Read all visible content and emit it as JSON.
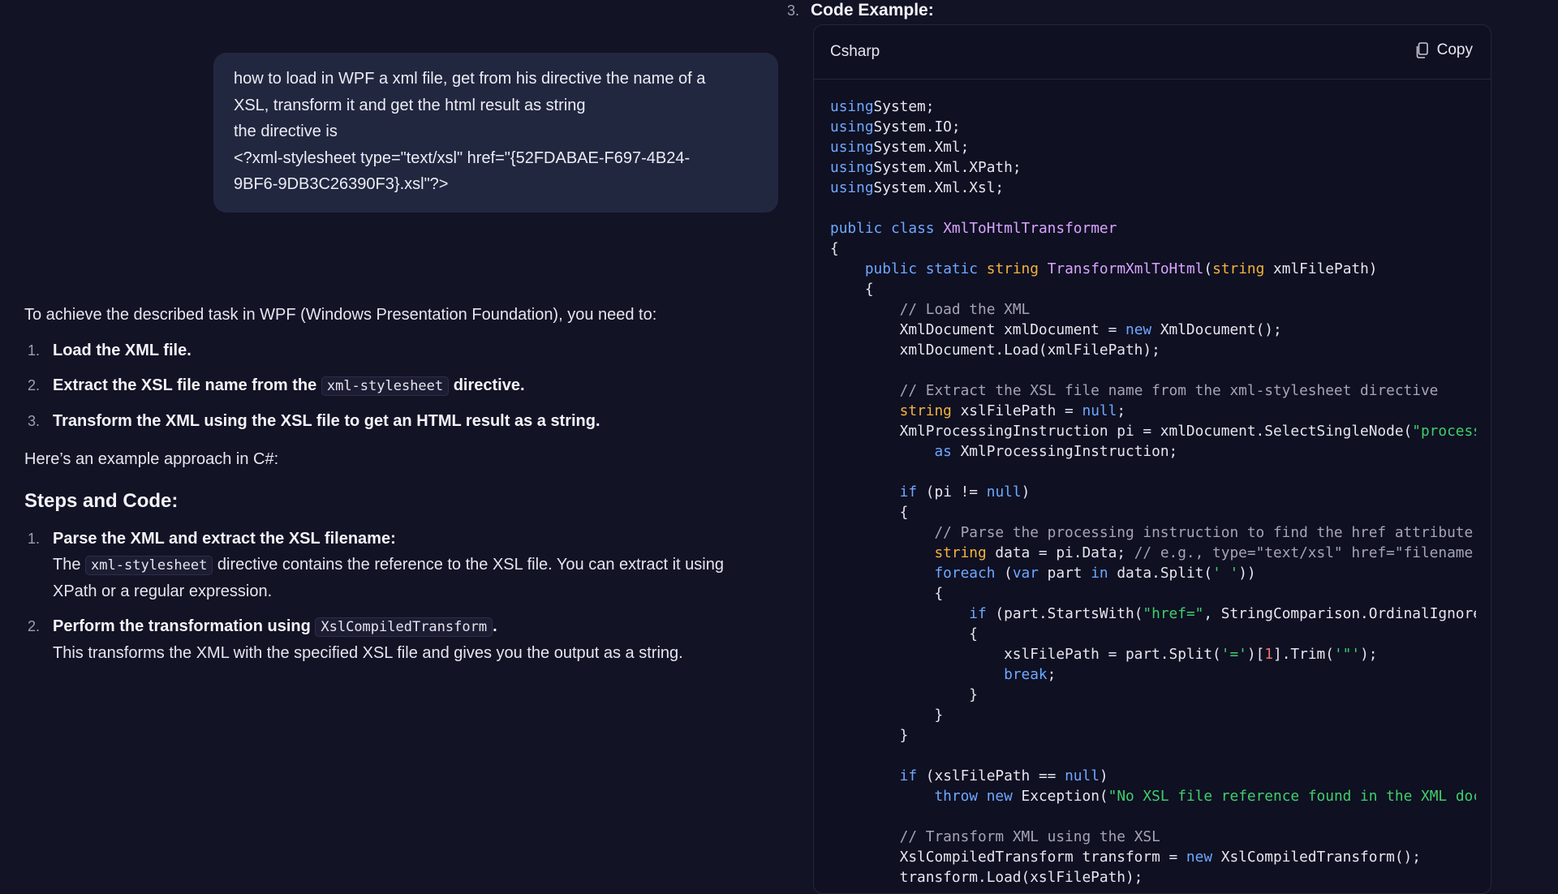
{
  "user_message": {
    "lines": [
      "how to load in WPF a xml file, get from his directive the name of a",
      "XSL, transform it and get the html result as string",
      "the directive is",
      "<?xml-stylesheet type=\"text/xsl\" href=\"{52FDABAE-F697-4B24-",
      "9BF6-9DB3C26390F3}.xsl\"?>"
    ]
  },
  "answer": {
    "intro": "To achieve the described task in WPF (Windows Presentation Foundation), you need to:",
    "steps": [
      {
        "num": "1.",
        "text": "Load the XML file."
      },
      {
        "num": "2.",
        "before": "Extract the XSL file name from the ",
        "code": "xml-stylesheet",
        "after": " directive."
      },
      {
        "num": "3.",
        "text": "Transform the XML using the XSL file to get an HTML result as a string."
      }
    ],
    "example_line": "Here’s an example approach in C#:",
    "section_title": "Steps and Code:",
    "sub_steps": [
      {
        "num": "1.",
        "title": "Parse the XML and extract the XSL filename:",
        "desc_before": "The ",
        "desc_code": "xml-stylesheet",
        "desc_after": " directive contains the reference to the XSL file. You can extract it using XPath or a regular expression."
      },
      {
        "num": "2.",
        "title": "Perform the transformation using ",
        "title_code": "XslCompiledTransform",
        "title_after": ".",
        "desc": "This transforms the XML with the specified XSL file and gives you the output as a string."
      }
    ]
  },
  "code_section": {
    "step_num": "3.",
    "step_title": "Code Example:",
    "language": "Csharp",
    "copy_label": "Copy",
    "lines": [
      [
        [
          "kw",
          "using"
        ],
        [
          "",
          "System;"
        ]
      ],
      [
        [
          "kw",
          "using"
        ],
        [
          "",
          "System.IO;"
        ]
      ],
      [
        [
          "kw",
          "using"
        ],
        [
          "",
          "System.Xml;"
        ]
      ],
      [
        [
          "kw",
          "using"
        ],
        [
          "",
          "System.Xml.XPath;"
        ]
      ],
      [
        [
          "kw",
          "using"
        ],
        [
          "",
          "System.Xml.Xsl;"
        ]
      ],
      [],
      [
        [
          "kw",
          "public"
        ],
        [
          "",
          " "
        ],
        [
          "kw",
          "class"
        ],
        [
          "",
          " "
        ],
        [
          "fn",
          "XmlToHtmlTransformer"
        ]
      ],
      [
        [
          "",
          "{"
        ]
      ],
      [
        [
          "",
          "    "
        ],
        [
          "kw",
          "public"
        ],
        [
          "",
          " "
        ],
        [
          "kw",
          "static"
        ],
        [
          "",
          " "
        ],
        [
          "ty",
          "string"
        ],
        [
          "",
          " "
        ],
        [
          "fn",
          "TransformXmlToHtml"
        ],
        [
          "",
          "("
        ],
        [
          "ty",
          "string"
        ],
        [
          "",
          " xmlFilePath)"
        ]
      ],
      [
        [
          "",
          "    {"
        ]
      ],
      [
        [
          "",
          "        "
        ],
        [
          "cm",
          "// Load the XML"
        ]
      ],
      [
        [
          "",
          "        XmlDocument xmlDocument = "
        ],
        [
          "kw",
          "new"
        ],
        [
          "",
          " XmlDocument();"
        ]
      ],
      [
        [
          "",
          "        xmlDocument.Load(xmlFilePath);"
        ]
      ],
      [],
      [
        [
          "",
          "        "
        ],
        [
          "cm",
          "// Extract the XSL file name from the xml-stylesheet directive"
        ]
      ],
      [
        [
          "",
          "        "
        ],
        [
          "ty",
          "string"
        ],
        [
          "",
          " xslFilePath = "
        ],
        [
          "kw",
          "null"
        ],
        [
          ";"
        ]
      ],
      [
        [
          "",
          "        XmlProcessingInstruction pi = xmlDocument.SelectSingleNode("
        ],
        [
          "st",
          "\"processing-instruction('xml-stylesheet')\""
        ],
        [
          ")"
        ]
      ],
      [
        [
          "",
          "            "
        ],
        [
          "kw",
          "as"
        ],
        [
          "",
          " XmlProcessingInstruction;"
        ]
      ],
      [],
      [
        [
          "",
          "        "
        ],
        [
          "kw",
          "if"
        ],
        [
          "",
          " (pi != "
        ],
        [
          "kw",
          "null"
        ],
        [
          ")"
        ]
      ],
      [
        [
          "",
          "        {"
        ]
      ],
      [
        [
          "",
          "            "
        ],
        [
          "cm",
          "// Parse the processing instruction to find the href attribute"
        ]
      ],
      [
        [
          "",
          "            "
        ],
        [
          "ty",
          "string"
        ],
        [
          "",
          " data = pi.Data; "
        ],
        [
          "cm",
          "// e.g., type=\"text/xsl\" href=\"filename.xsl\""
        ]
      ],
      [
        [
          "",
          "            "
        ],
        [
          "kw",
          "foreach"
        ],
        [
          "",
          " ("
        ],
        [
          "kw",
          "var"
        ],
        [
          "",
          " part "
        ],
        [
          "kw",
          "in"
        ],
        [
          "",
          " data.Split("
        ],
        [
          "st",
          "' '"
        ],
        [
          "",
          "))"
        ]
      ],
      [
        [
          "",
          "            {"
        ]
      ],
      [
        [
          "",
          "                "
        ],
        [
          "kw",
          "if"
        ],
        [
          "",
          " (part.StartsWith("
        ],
        [
          "st",
          "\"href=\""
        ],
        [
          "",
          ", StringComparison.OrdinalIgnoreCase))"
        ]
      ],
      [
        [
          "",
          "                {"
        ]
      ],
      [
        [
          "",
          "                    xslFilePath = part.Split("
        ],
        [
          "st",
          "'='"
        ],
        [
          "",
          ")["
        ],
        [
          "nm",
          "1"
        ],
        [
          "",
          "].Trim("
        ],
        [
          "st",
          "'\"'"
        ],
        [
          "",
          ");"
        ]
      ],
      [
        [
          "",
          "                    "
        ],
        [
          "kw",
          "break"
        ],
        [
          "",
          ";"
        ]
      ],
      [
        [
          "",
          "                }"
        ]
      ],
      [
        [
          "",
          "            }"
        ]
      ],
      [
        [
          "",
          "        }"
        ]
      ],
      [],
      [
        [
          "",
          "        "
        ],
        [
          "kw",
          "if"
        ],
        [
          "",
          " (xslFilePath == "
        ],
        [
          "kw",
          "null"
        ],
        [
          "",
          ")"
        ]
      ],
      [
        [
          "",
          "            "
        ],
        [
          "kw",
          "throw"
        ],
        [
          "",
          " "
        ],
        [
          "kw",
          "new"
        ],
        [
          "",
          " Exception("
        ],
        [
          "st",
          "\"No XSL file reference found in the XML document.\""
        ],
        [
          "",
          ");"
        ]
      ],
      [],
      [
        [
          "",
          "        "
        ],
        [
          "cm",
          "// Transform XML using the XSL"
        ]
      ],
      [
        [
          "",
          "        XslCompiledTransform transform = "
        ],
        [
          "kw",
          "new"
        ],
        [
          "",
          " XslCompiledTransform();"
        ]
      ],
      [
        [
          "",
          "        transform.Load(xslFilePath);"
        ]
      ]
    ]
  }
}
